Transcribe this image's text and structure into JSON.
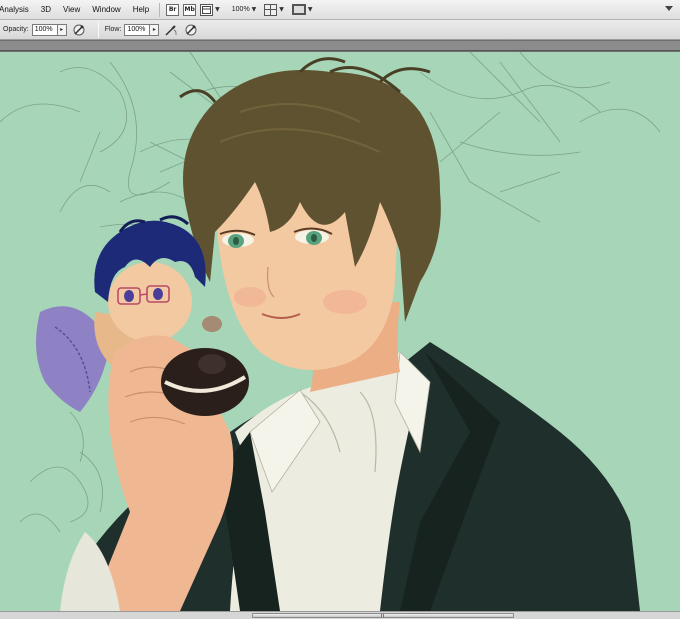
{
  "menubar": {
    "items": [
      "Analysis",
      "3D",
      "View",
      "Window",
      "Help"
    ],
    "zoom": "100%",
    "icons": [
      "bridge-icon",
      "mini-bridge-icon",
      "view-extras-icon",
      "arrange-documents-icon",
      "screen-mode-icon"
    ],
    "icon_labels": {
      "bridge": "Br",
      "mini_bridge": "Mb"
    }
  },
  "options_bar": {
    "opacity_label": "Opacity:",
    "opacity_value": "100%",
    "flow_label": "Flow:",
    "flow_value": "100%",
    "dropdown_arrow": "▸"
  },
  "colors": {
    "canvas_background": "#a6d5b7",
    "hair": "#5f5230",
    "jacket": "#1f2f2b",
    "shirt": "#ecece0",
    "skin": "#f3c9a2",
    "eyes": "#59a37e",
    "chibi_hair": "#1d2a78",
    "chibi_wings": "#8f82c4"
  }
}
